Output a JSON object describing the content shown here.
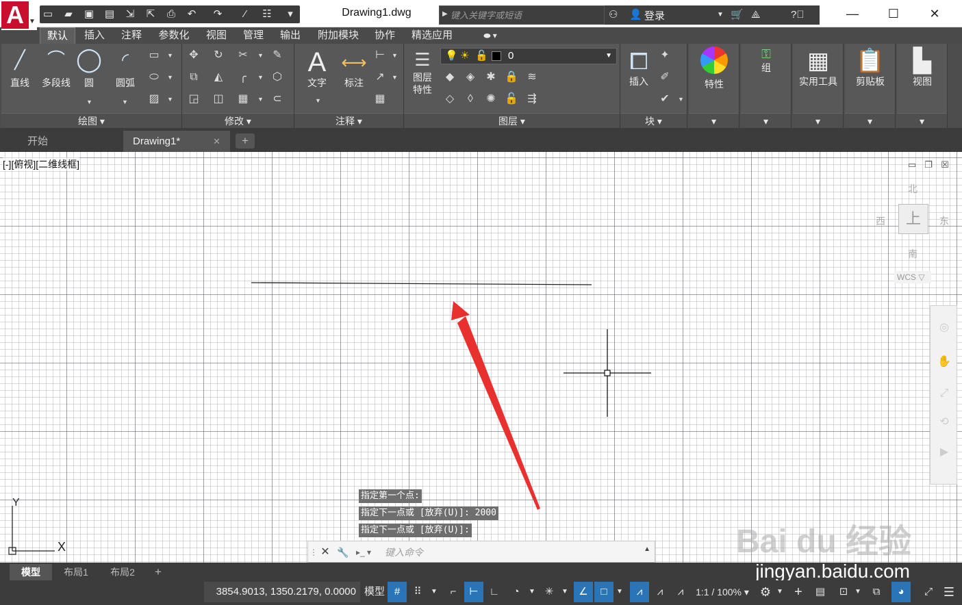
{
  "colors": {
    "ribbon_bg": "#585858",
    "accent_blue": "#2a75b8",
    "logo_red": "#c8102e",
    "arrow_red": "#e8302e"
  },
  "app": {
    "logo_letter": "A",
    "document_title": "Drawing1.dwg"
  },
  "quick_access": {
    "icons": [
      "new-file-icon",
      "open-icon",
      "save-icon",
      "save-as-icon",
      "import-icon",
      "export-icon",
      "print-icon",
      "undo-icon",
      "redo-icon",
      "match-icon",
      "properties-icon",
      "more-icon"
    ]
  },
  "search": {
    "placeholder": "键入关键字或短语"
  },
  "user": {
    "login_label": "登录"
  },
  "ribbon_tabs": [
    {
      "label": "默认",
      "active": true
    },
    {
      "label": "插入"
    },
    {
      "label": "注释"
    },
    {
      "label": "参数化"
    },
    {
      "label": "视图"
    },
    {
      "label": "管理"
    },
    {
      "label": "输出"
    },
    {
      "label": "附加模块"
    },
    {
      "label": "协作"
    },
    {
      "label": "精选应用"
    }
  ],
  "panels": {
    "draw": {
      "title": "绘图",
      "tools": [
        "直线",
        "多段线",
        "圆",
        "圆弧"
      ]
    },
    "modify": {
      "title": "修改"
    },
    "annotation": {
      "title": "注释",
      "tools": [
        "文字",
        "标注"
      ]
    },
    "layers": {
      "title": "图层",
      "layer_props_line1": "图层",
      "layer_props_line2": "特性",
      "current_layer": "0"
    },
    "block": {
      "title": "块",
      "tools": [
        "插入"
      ]
    },
    "properties": {
      "label": "特性"
    },
    "group": {
      "label": "组"
    },
    "utilities": {
      "label": "实用工具"
    },
    "clipboard": {
      "label": "剪贴板"
    },
    "view": {
      "label": "视图"
    }
  },
  "file_tabs": [
    {
      "label": "开始"
    },
    {
      "label": "Drawing1*",
      "active": true
    }
  ],
  "viewport": {
    "label": "[-][俯视][二维线框]",
    "compass": {
      "north": "北",
      "south": "南",
      "east": "东",
      "west": "西"
    },
    "cube_face": "上",
    "wcs": "WCS",
    "ucs_x": "X",
    "ucs_y": "Y"
  },
  "command_history": [
    "指定第一个点:",
    "指定下一点或 [放弃(U)]: 2000",
    "指定下一点或 [放弃(U)]:"
  ],
  "command_line": {
    "placeholder": "键入命令"
  },
  "watermark": {
    "logo_text": "Bai du 经验",
    "url": "jingyan.baidu.com"
  },
  "layout_tabs": [
    {
      "label": "模型",
      "active": true
    },
    {
      "label": "布局1"
    },
    {
      "label": "布局2"
    }
  ],
  "status_bar": {
    "coordinates": "3854.9013, 1350.2179, 0.0000",
    "model_label": "模型",
    "annotation_scale": "1:1 / 100%"
  }
}
